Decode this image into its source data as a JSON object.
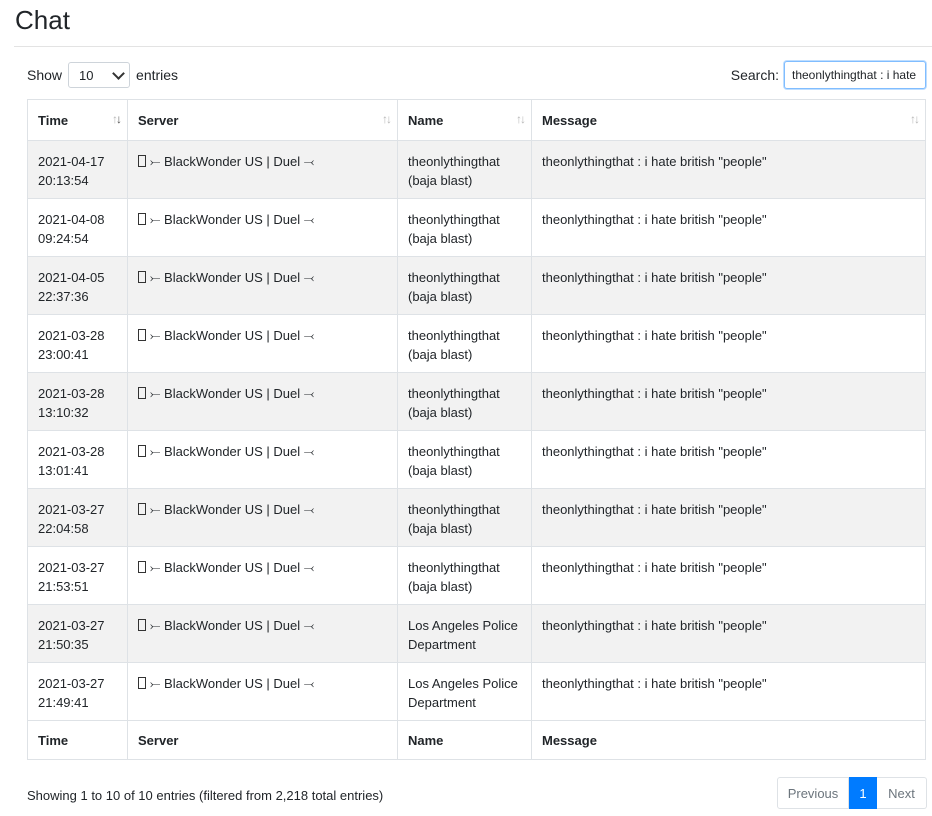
{
  "page": {
    "title": "Chat"
  },
  "controls": {
    "show_label": "Show",
    "entries_label": "entries",
    "page_length": "10",
    "search_label": "Search:",
    "search_value": "theonlythingthat : i hate"
  },
  "table": {
    "columns": [
      "Time",
      "Server",
      "Name",
      "Message"
    ],
    "rows": [
      {
        "date": "2021-04-17",
        "time": "20:13:54",
        "server": "BlackWonder US | Duel",
        "name1": "theonlythingthat",
        "name2": "(baja blast)",
        "message": "theonlythingthat : i hate british \"people\""
      },
      {
        "date": "2021-04-08",
        "time": "09:24:54",
        "server": "BlackWonder US | Duel",
        "name1": "theonlythingthat",
        "name2": "(baja blast)",
        "message": "theonlythingthat : i hate british \"people\""
      },
      {
        "date": "2021-04-05",
        "time": "22:37:36",
        "server": "BlackWonder US | Duel",
        "name1": "theonlythingthat",
        "name2": "(baja blast)",
        "message": "theonlythingthat : i hate british \"people\""
      },
      {
        "date": "2021-03-28",
        "time": "23:00:41",
        "server": "BlackWonder US | Duel",
        "name1": "theonlythingthat",
        "name2": "(baja blast)",
        "message": "theonlythingthat : i hate british \"people\""
      },
      {
        "date": "2021-03-28",
        "time": "13:10:32",
        "server": "BlackWonder US | Duel",
        "name1": "theonlythingthat",
        "name2": "(baja blast)",
        "message": "theonlythingthat : i hate british \"people\""
      },
      {
        "date": "2021-03-28",
        "time": "13:01:41",
        "server": "BlackWonder US | Duel",
        "name1": "theonlythingthat",
        "name2": "(baja blast)",
        "message": "theonlythingthat : i hate british \"people\""
      },
      {
        "date": "2021-03-27",
        "time": "22:04:58",
        "server": "BlackWonder US | Duel",
        "name1": "theonlythingthat",
        "name2": "(baja blast)",
        "message": "theonlythingthat : i hate british \"people\""
      },
      {
        "date": "2021-03-27",
        "time": "21:53:51",
        "server": "BlackWonder US | Duel",
        "name1": "theonlythingthat",
        "name2": "(baja blast)",
        "message": "theonlythingthat : i hate british \"people\""
      },
      {
        "date": "2021-03-27",
        "time": "21:50:35",
        "server": "BlackWonder US | Duel",
        "name1": "Los Angeles Police",
        "name2": "Department",
        "message": "theonlythingthat : i hate british \"people\""
      },
      {
        "date": "2021-03-27",
        "time": "21:49:41",
        "server": "BlackWonder US | Duel",
        "name1": "Los Angeles Police",
        "name2": "Department",
        "message": "theonlythingthat : i hate british \"people\""
      }
    ]
  },
  "footer": {
    "info": "Showing 1 to 10 of 10 entries (filtered from 2,218 total entries)",
    "prev": "Previous",
    "page": "1",
    "next": "Next"
  },
  "colors": {
    "accent": "#007bff",
    "stripe": "#f2f2f2",
    "border": "#dee2e6"
  },
  "icons": {
    "server_prefix": "flag-icon",
    "server_suffix": "flag-icon"
  }
}
